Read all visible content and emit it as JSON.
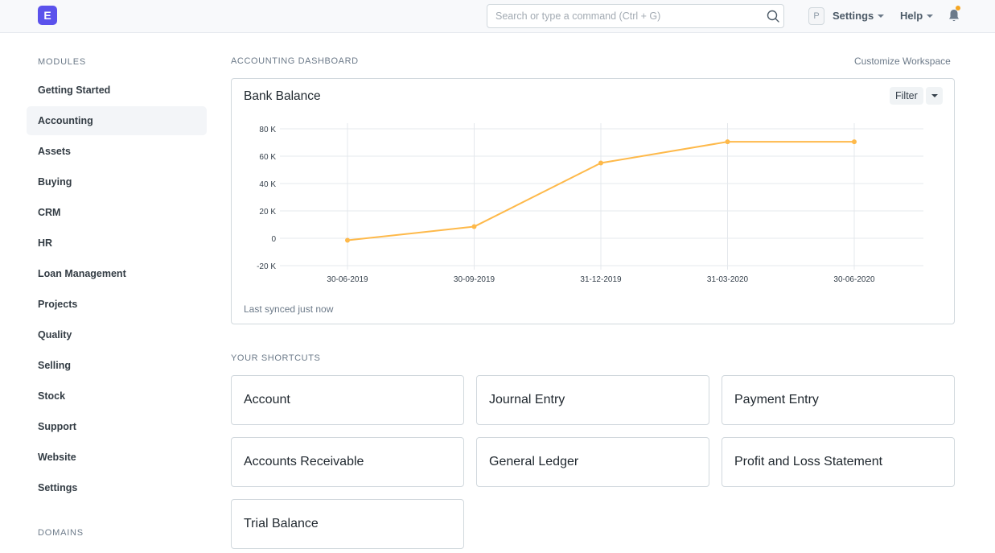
{
  "navbar": {
    "logo_letter": "E",
    "search_placeholder": "Search or type a command (Ctrl + G)",
    "avatar_letter": "P",
    "settings_label": "Settings",
    "help_label": "Help"
  },
  "sidebar": {
    "modules_heading": "MODULES",
    "items": [
      {
        "label": "Getting Started"
      },
      {
        "label": "Accounting",
        "active": true
      },
      {
        "label": "Assets"
      },
      {
        "label": "Buying"
      },
      {
        "label": "CRM"
      },
      {
        "label": "HR"
      },
      {
        "label": "Loan Management"
      },
      {
        "label": "Projects"
      },
      {
        "label": "Quality"
      },
      {
        "label": "Selling"
      },
      {
        "label": "Stock"
      },
      {
        "label": "Support"
      },
      {
        "label": "Website"
      },
      {
        "label": "Settings"
      }
    ],
    "domains_heading": "DOMAINS"
  },
  "main": {
    "dashboard_heading": "ACCOUNTING DASHBOARD",
    "customize_label": "Customize Workspace",
    "card": {
      "title": "Bank Balance",
      "filter_label": "Filter",
      "synced_text": "Last synced just now"
    },
    "shortcuts_heading": "YOUR SHORTCUTS",
    "shortcuts": [
      {
        "label": "Account"
      },
      {
        "label": "Journal Entry"
      },
      {
        "label": "Payment Entry"
      },
      {
        "label": "Accounts Receivable"
      },
      {
        "label": "General Ledger"
      },
      {
        "label": "Profit and Loss Statement"
      },
      {
        "label": "Trial Balance"
      }
    ]
  },
  "colors": {
    "brand": "#5b52ec",
    "line": "#feb94a",
    "notification": "#f5a623"
  },
  "chart_data": {
    "type": "line",
    "title": "Bank Balance",
    "x": [
      "30-06-2019",
      "30-09-2019",
      "31-12-2019",
      "31-03-2020",
      "30-06-2020"
    ],
    "series": [
      {
        "values": [
          -1500,
          8500,
          55000,
          70500,
          70500
        ]
      }
    ],
    "ytick_labels": [
      "80 K",
      "60 K",
      "40 K",
      "20 K",
      "0",
      "-20 K"
    ],
    "ytick_values": [
      80000,
      60000,
      40000,
      20000,
      0,
      -20000
    ],
    "ylim": [
      -20000,
      80000
    ],
    "grid": true,
    "legend": "none"
  }
}
